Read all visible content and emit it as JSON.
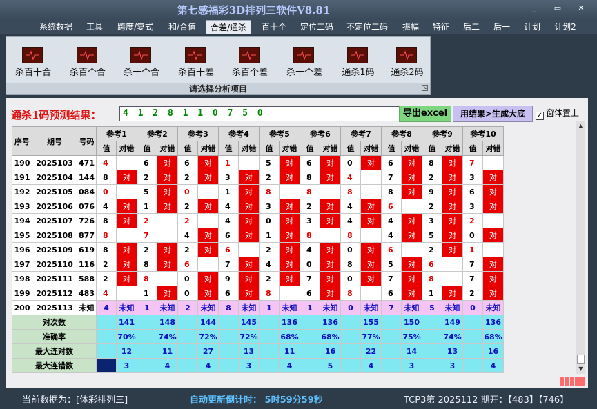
{
  "window": {
    "title": "第七感福彩3D排列三软件V8.81",
    "controls": [
      "_",
      "▭",
      "✕"
    ]
  },
  "menu": [
    "系统数据",
    "工具",
    "跨度/复式",
    "和/合值",
    "合差/通杀",
    "百十个",
    "定位二码",
    "不定位二码",
    "振幅",
    "特征",
    "后二",
    "后一",
    "计划",
    "计划2"
  ],
  "menu_active": "合差/通杀",
  "ribbon": {
    "buttons": [
      "杀百十合",
      "杀百个合",
      "杀十个合",
      "杀百十差",
      "杀百个差",
      "杀十个差",
      "通杀1码",
      "通杀2码"
    ],
    "caption": "请选择分析项目"
  },
  "predict": {
    "label": "通杀1码预测结果：",
    "value": "4 1 2 8 1 1 0 7 5 0",
    "excel_button": "导出excel",
    "apply_button": "用结果>生成大底",
    "topmost_label": "窗体置上",
    "topmost_checked": true
  },
  "grid": {
    "col_headers": {
      "seq": "序号",
      "period": "期号",
      "number": "号码"
    },
    "ref_headers": [
      "参考1",
      "参考2",
      "参考3",
      "参考4",
      "参考5",
      "参考6",
      "参考7",
      "参考8",
      "参考9",
      "参考10"
    ],
    "sub_headers": [
      "值",
      "对错"
    ],
    "hit_text": "对",
    "rows": [
      {
        "seq": "190",
        "period": "2025103",
        "num": "471",
        "vals": [
          "4",
          "6",
          "6",
          "1",
          "5",
          "6",
          "0",
          "6",
          "8",
          "7"
        ],
        "hits": [
          false,
          true,
          true,
          false,
          true,
          true,
          true,
          true,
          true,
          false
        ]
      },
      {
        "seq": "191",
        "period": "2025104",
        "num": "144",
        "vals": [
          "8",
          "2",
          "2",
          "3",
          "2",
          "8",
          "4",
          "7",
          "2",
          "3"
        ],
        "hits": [
          true,
          true,
          true,
          true,
          true,
          true,
          false,
          true,
          true,
          true
        ]
      },
      {
        "seq": "192",
        "period": "2025105",
        "num": "084",
        "vals": [
          "0",
          "5",
          "0",
          "1",
          "8",
          "8",
          "8",
          "8",
          "9",
          "6"
        ],
        "hits": [
          false,
          true,
          false,
          true,
          false,
          false,
          false,
          true,
          true,
          true
        ]
      },
      {
        "seq": "193",
        "period": "2025106",
        "num": "076",
        "vals": [
          "4",
          "1",
          "2",
          "4",
          "3",
          "2",
          "4",
          "6",
          "2",
          "3"
        ],
        "hits": [
          true,
          true,
          true,
          true,
          true,
          true,
          true,
          false,
          true,
          true
        ]
      },
      {
        "seq": "194",
        "period": "2025107",
        "num": "726",
        "vals": [
          "8",
          "2",
          "2",
          "4",
          "0",
          "3",
          "4",
          "4",
          "3",
          "2"
        ],
        "hits": [
          true,
          false,
          false,
          true,
          true,
          true,
          true,
          true,
          true,
          false
        ]
      },
      {
        "seq": "195",
        "period": "2025108",
        "num": "877",
        "vals": [
          "8",
          "7",
          "4",
          "6",
          "1",
          "8",
          "8",
          "4",
          "5",
          "0"
        ],
        "hits": [
          false,
          false,
          true,
          true,
          true,
          false,
          false,
          true,
          true,
          true
        ]
      },
      {
        "seq": "196",
        "period": "2025109",
        "num": "619",
        "vals": [
          "8",
          "2",
          "2",
          "6",
          "2",
          "4",
          "0",
          "6",
          "2",
          "1"
        ],
        "hits": [
          true,
          true,
          true,
          false,
          true,
          true,
          true,
          false,
          true,
          false
        ]
      },
      {
        "seq": "197",
        "period": "2025110",
        "num": "116",
        "vals": [
          "2",
          "8",
          "6",
          "7",
          "4",
          "0",
          "8",
          "5",
          "6",
          "7"
        ],
        "hits": [
          true,
          true,
          false,
          true,
          true,
          true,
          true,
          true,
          false,
          true
        ]
      },
      {
        "seq": "198",
        "period": "2025111",
        "num": "588",
        "vals": [
          "2",
          "8",
          "0",
          "9",
          "2",
          "7",
          "0",
          "7",
          "8",
          "7"
        ],
        "hits": [
          true,
          false,
          true,
          true,
          true,
          true,
          true,
          true,
          false,
          true
        ]
      },
      {
        "seq": "199",
        "period": "2025112",
        "num": "483",
        "vals": [
          "4",
          "1",
          "0",
          "6",
          "8",
          "6",
          "8",
          "6",
          "1",
          "2"
        ],
        "hits": [
          false,
          true,
          true,
          true,
          false,
          true,
          false,
          true,
          true,
          true
        ]
      }
    ],
    "predict_row": {
      "seq": "200",
      "period": "2025113",
      "num": "未知",
      "vals": [
        "4",
        "1",
        "2",
        "8",
        "1",
        "1",
        "0",
        "7",
        "5",
        "0"
      ],
      "status": "未知"
    },
    "stats": [
      {
        "label": "对次数",
        "values": [
          "141",
          "148",
          "144",
          "145",
          "136",
          "136",
          "155",
          "150",
          "149",
          "136"
        ]
      },
      {
        "label": "准确率",
        "values": [
          "70%",
          "74%",
          "72%",
          "72%",
          "68%",
          "68%",
          "77%",
          "75%",
          "74%",
          "68%"
        ]
      },
      {
        "label": "最大连对数",
        "values": [
          "12",
          "11",
          "27",
          "13",
          "11",
          "16",
          "22",
          "14",
          "13",
          "16"
        ]
      },
      {
        "label": "最大连错数",
        "values": [
          "3",
          "4",
          "4",
          "3",
          "4",
          "5",
          "4",
          "3",
          "3",
          "4"
        ]
      }
    ]
  },
  "status": {
    "current_data": "当前数据为：[体彩排列三]",
    "countdown": "自动更新倒计时：  5时59分59秒",
    "draw": "TCP3第 2025112 期开：【483】【746】"
  }
}
